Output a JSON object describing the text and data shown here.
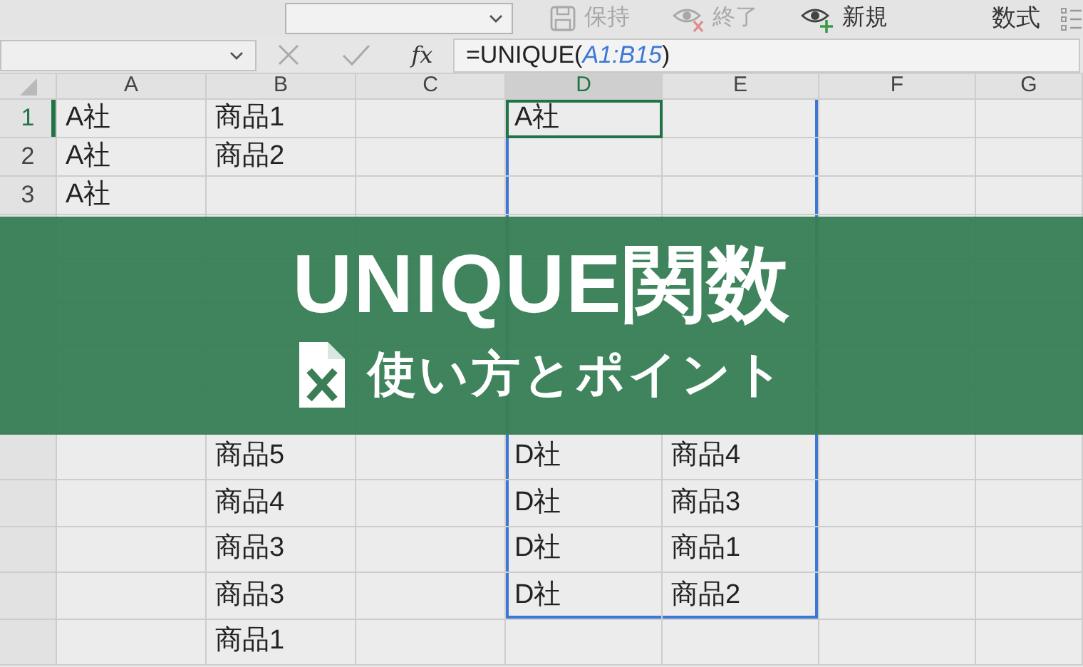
{
  "ribbon": {
    "tab": "数式",
    "buttons": [
      {
        "kind": "save",
        "label": "保持",
        "disabled": true
      },
      {
        "kind": "eye-cross",
        "label": "終了",
        "disabled": true
      },
      {
        "kind": "eye-plus",
        "label": "新規",
        "disabled": false
      }
    ]
  },
  "formula_bar": {
    "fx_label": "fx",
    "formula_start": "=UNIQUE(",
    "formula_range": "A1:B15",
    "formula_end": ")"
  },
  "sheet": {
    "columns": [
      {
        "label": "A",
        "selected": false,
        "spill": false
      },
      {
        "label": "B",
        "selected": false,
        "spill": false
      },
      {
        "label": "C",
        "selected": false,
        "spill": false
      },
      {
        "label": "D",
        "selected": true,
        "spill": true
      },
      {
        "label": "E",
        "selected": false,
        "spill": true
      },
      {
        "label": "F",
        "selected": false,
        "spill": false
      },
      {
        "label": "G",
        "selected": false,
        "spill": false
      }
    ],
    "rows": [
      {
        "number": "1",
        "selected": true,
        "cells": {
          "A": "A社",
          "B": "商品1",
          "D": "A社"
        }
      },
      {
        "number": "2",
        "selected": false,
        "cells": {
          "A": "A社",
          "B": "商品2"
        }
      },
      {
        "number": "3",
        "selected": false,
        "cells": {
          "A": "A社"
        }
      },
      {
        "cells": {}
      },
      {
        "cells": {}
      },
      {
        "cells": {}
      },
      {
        "cells": {}
      },
      {
        "cells": {}
      },
      {
        "cells": {
          "B": "商品5",
          "D": "D社",
          "E": "商品4"
        }
      },
      {
        "cells": {
          "B": "商品4",
          "D": "D社",
          "E": "商品3"
        }
      },
      {
        "cells": {
          "B": "商品3",
          "D": "D社",
          "E": "商品1"
        }
      },
      {
        "cells": {
          "B": "商品3",
          "D": "D社",
          "E": "商品2"
        }
      },
      {
        "cells": {
          "B": "商品1"
        }
      }
    ]
  },
  "banner": {
    "title": "UNIQUE関数",
    "subtitle": "使い方とポイント"
  }
}
